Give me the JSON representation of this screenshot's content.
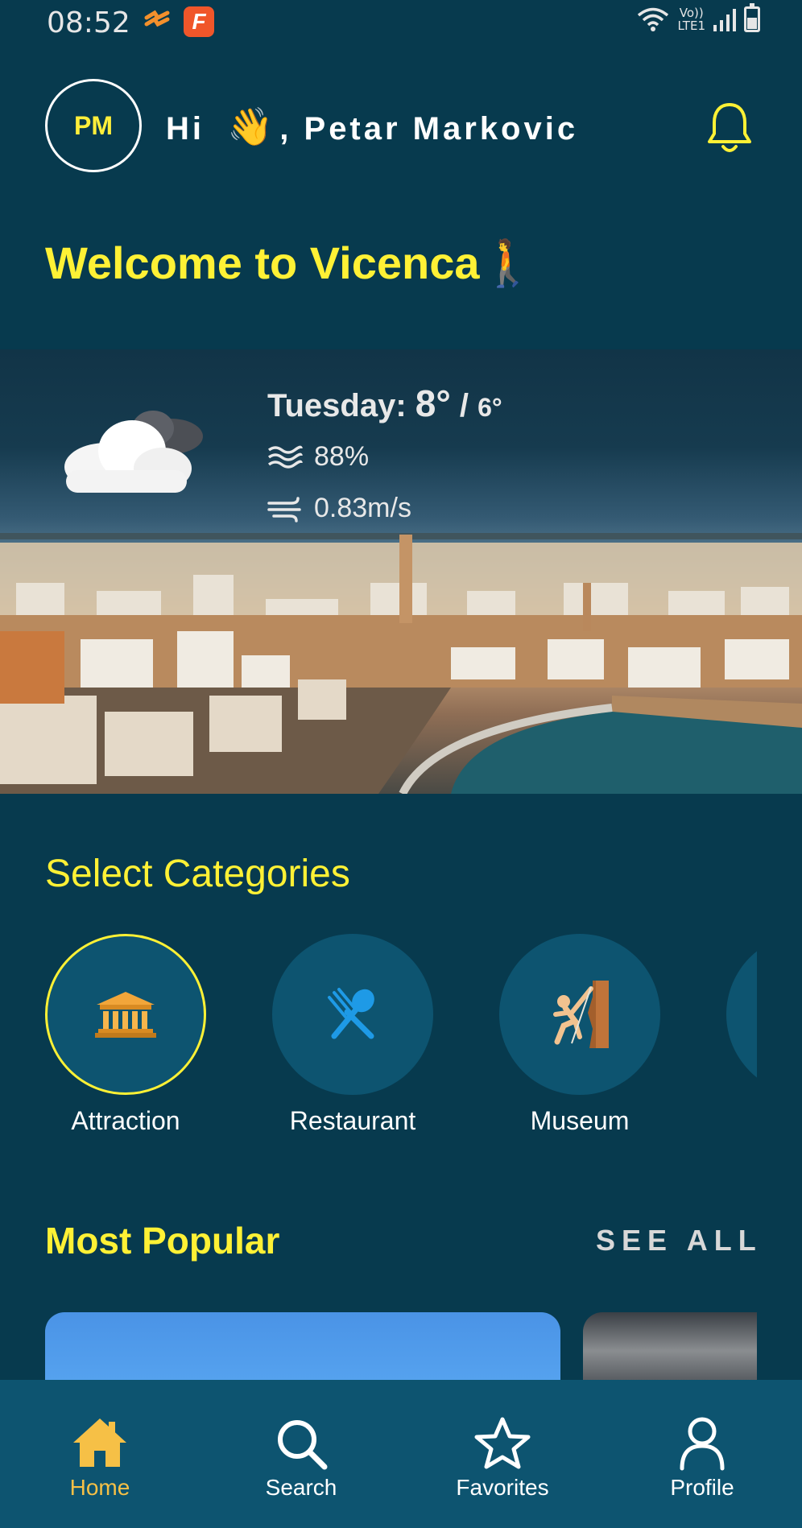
{
  "status_bar": {
    "time": "08:52",
    "network_top": "Vo))",
    "network_bottom": "LTE1"
  },
  "header": {
    "avatar_initials": "PM",
    "greeting_prefix": "Hi",
    "wave_emoji": "👋",
    "greeting_name": ", Petar Markovic"
  },
  "welcome": {
    "title": "Welcome to Vicenca",
    "walker_emoji": "🚶"
  },
  "weather": {
    "day": "Tuesday:",
    "high": "8°",
    "separator": "/",
    "low": "6°",
    "humidity": "88%",
    "wind": "0.83m/s"
  },
  "categories": {
    "title": "Select Categories",
    "items": [
      {
        "label": "Attraction",
        "icon": "classical-building-icon",
        "selected": true
      },
      {
        "label": "Restaurant",
        "icon": "fork-and-spoon-icon",
        "selected": false
      },
      {
        "label": "Museum",
        "icon": "person-climbing-icon",
        "selected": false
      }
    ]
  },
  "popular": {
    "title": "Most Popular",
    "see_all": "SEE ALL"
  },
  "bottom_nav": {
    "items": [
      {
        "label": "Home",
        "icon": "home-icon",
        "active": true
      },
      {
        "label": "Search",
        "icon": "search-icon",
        "active": false
      },
      {
        "label": "Favorites",
        "icon": "star-icon",
        "active": false
      },
      {
        "label": "Profile",
        "icon": "user-icon",
        "active": false
      }
    ]
  },
  "colors": {
    "background": "#073a4e",
    "accent_yellow": "#fff135",
    "nav_background": "#0d5470",
    "active_nav": "#f6c046"
  }
}
